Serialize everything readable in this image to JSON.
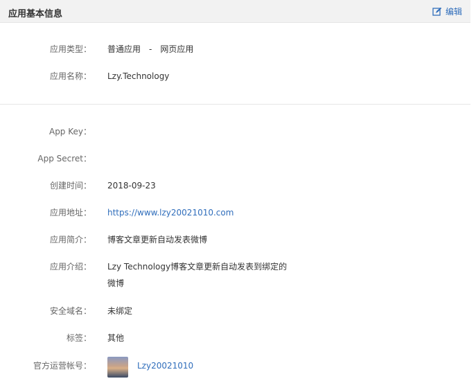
{
  "header": {
    "title": "应用基本信息",
    "edit_label": "编辑"
  },
  "fields": {
    "type": {
      "label": "应用类型：",
      "value": "普通应用　-　网页应用"
    },
    "name": {
      "label": "应用名称：",
      "value": "Lzy.Technology"
    },
    "app_key": {
      "label": "App Key：",
      "value": ""
    },
    "app_secret": {
      "label": "App Secret：",
      "value": ""
    },
    "created": {
      "label": "创建时间：",
      "value": "2018-09-23"
    },
    "url": {
      "label": "应用地址：",
      "value": "https://www.lzy20021010.com"
    },
    "summary": {
      "label": "应用简介：",
      "value": "博客文章更新自动发表微博"
    },
    "intro": {
      "label": "应用介绍：",
      "value": "Lzy Technology博客文章更新自动发表到绑定的微博"
    },
    "domain": {
      "label": "安全域名：",
      "value": "未绑定"
    },
    "tags": {
      "label": "标签：",
      "value": "其他"
    },
    "official": {
      "label": "官方运营帐号：",
      "value": "Lzy20021010"
    }
  },
  "colors": {
    "link": "#2f6dbb",
    "header_bg": "#f2f2f2"
  }
}
